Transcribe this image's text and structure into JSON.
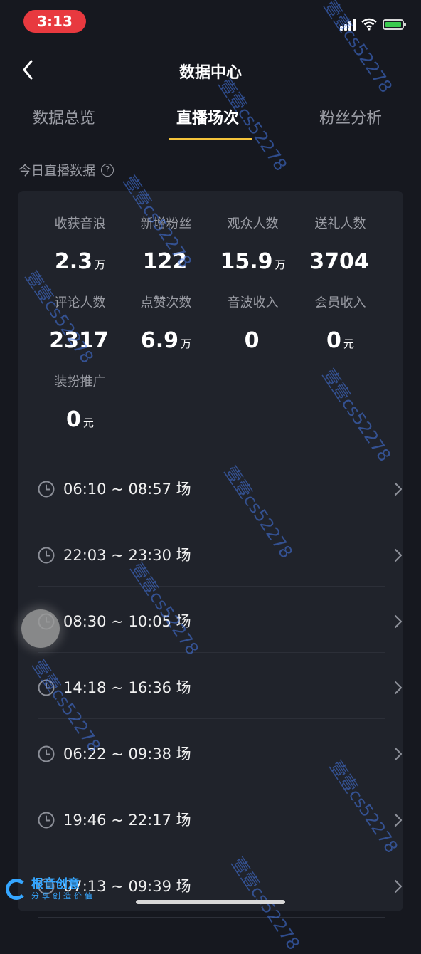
{
  "status_bar": {
    "time": "3:13"
  },
  "nav": {
    "title": "数据中心"
  },
  "tabs": [
    {
      "label": "数据总览",
      "active": false
    },
    {
      "label": "直播场次",
      "active": true
    },
    {
      "label": "粉丝分析",
      "active": false
    }
  ],
  "section": {
    "title": "今日直播数据",
    "help": "?"
  },
  "stats": [
    {
      "label": "收获音浪",
      "value": "2.3",
      "unit": "万"
    },
    {
      "label": "新增粉丝",
      "value": "122",
      "unit": ""
    },
    {
      "label": "观众人数",
      "value": "15.9",
      "unit": "万"
    },
    {
      "label": "送礼人数",
      "value": "3704",
      "unit": ""
    },
    {
      "label": "评论人数",
      "value": "2317",
      "unit": ""
    },
    {
      "label": "点赞次数",
      "value": "6.9",
      "unit": "万"
    },
    {
      "label": "音波收入",
      "value": "0",
      "unit": ""
    },
    {
      "label": "会员收入",
      "value": "0",
      "unit": "元"
    },
    {
      "label": "装扮推广",
      "value": "0",
      "unit": "元"
    }
  ],
  "sessions": [
    {
      "label": "06:10 ~ 08:57 场"
    },
    {
      "label": "22:03 ~ 23:30 场"
    },
    {
      "label": "08:30 ~ 10:05 场"
    },
    {
      "label": "14:18 ~ 16:36 场"
    },
    {
      "label": "06:22 ~ 09:38 场"
    },
    {
      "label": "19:46 ~ 22:17 场"
    },
    {
      "label": "07:13 ~ 09:39 场"
    }
  ],
  "watermark": {
    "text": "壹壹cs52278"
  },
  "logo": {
    "main": "根音创意",
    "sub": "分享创造价值"
  },
  "colors": {
    "accent": "#f5c43b",
    "background": "#16181f",
    "card": "#20232b",
    "time_pill": "#e8393f"
  }
}
